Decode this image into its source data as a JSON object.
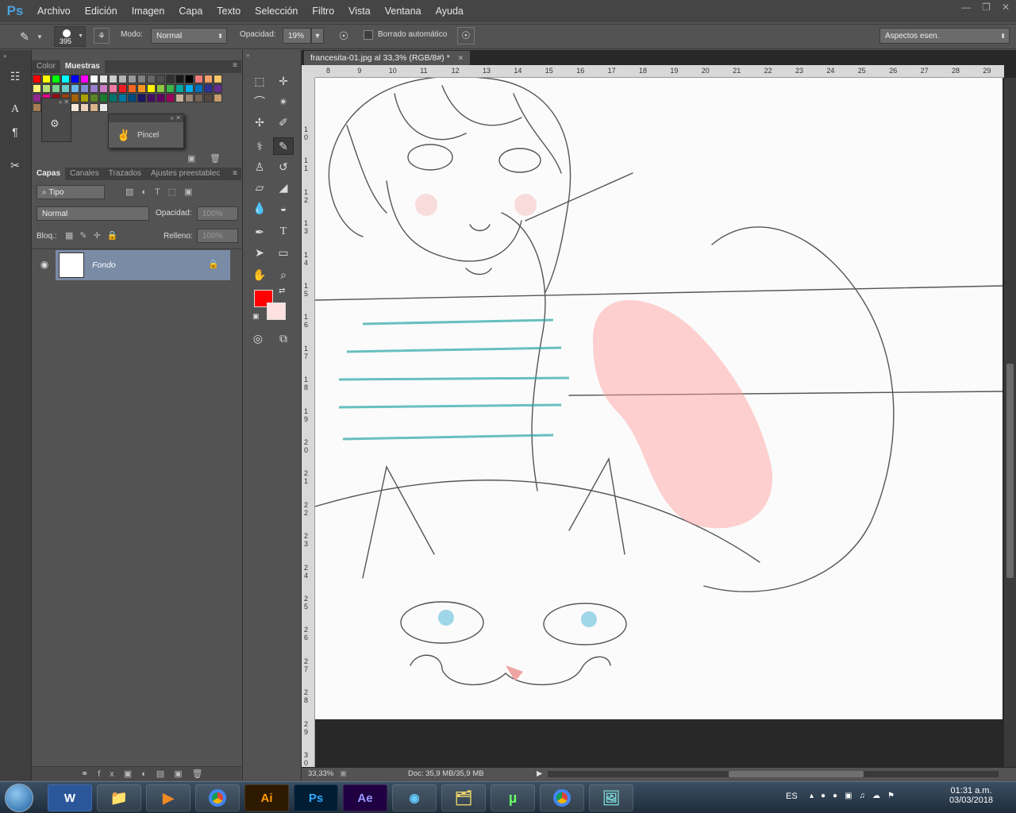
{
  "app": {
    "logo": "Ps"
  },
  "menu": [
    "Archivo",
    "Edición",
    "Imagen",
    "Capa",
    "Texto",
    "Selección",
    "Filtro",
    "Vista",
    "Ventana",
    "Ayuda"
  ],
  "options": {
    "brush_size": "395",
    "mode_label": "Modo:",
    "mode_value": "Normal",
    "opacity_label": "Opacidad:",
    "opacity_value": "19%",
    "auto_erase_label": "Borrado automático",
    "workspace": "Aspectos esen."
  },
  "swatch_panel": {
    "tabs": [
      "Color",
      "Muestras"
    ],
    "popup_label": "Pincel"
  },
  "layers_panel": {
    "tabs": [
      "Capas",
      "Canales",
      "Trazados",
      "Ajustes preestablec"
    ],
    "filter_label": "Tipo",
    "blend_mode": "Normal",
    "opacity_label": "Opacidad:",
    "opacity_value": "100%",
    "lock_label": "Bloq.:",
    "fill_label": "Relleno:",
    "fill_value": "100%",
    "layer_name": "Fondo"
  },
  "document": {
    "tab_title": "francesita-01.jpg al 33,3% (RGB/8#) *"
  },
  "ruler_top": [
    "8",
    "9",
    "10",
    "11",
    "12",
    "13",
    "14",
    "15",
    "16",
    "17",
    "18",
    "19",
    "20",
    "21",
    "22",
    "23",
    "24",
    "25",
    "26",
    "27",
    "28",
    "29"
  ],
  "ruler_left": [
    "1 0",
    "1 1",
    "1 2",
    "1 3",
    "1 4",
    "1 5",
    "1 6",
    "1 7",
    "1 8",
    "1 9",
    "2 0",
    "2 1",
    "2 2",
    "2 3",
    "2 4",
    "2 5",
    "2 6",
    "2 7",
    "2 8",
    "2 9",
    "3 0"
  ],
  "status": {
    "zoom": "33,33%",
    "doc_info": "Doc: 35,9 MB/35,9 MB"
  },
  "colors": {
    "foreground": "#ff0000",
    "background": "#fde0e0",
    "layer_selected": "#7a8ba6"
  },
  "taskbar": {
    "lang": "ES",
    "time": "01:31 a.m.",
    "date": "03/03/2018",
    "apps": [
      "word-icon",
      "folder-icon",
      "media-player-icon",
      "chrome-icon",
      "illustrator-icon",
      "photoshop-icon",
      "after-effects-icon",
      "camera-icon",
      "files-icon",
      "utorrent-icon",
      "chrome-icon",
      "photos-icon"
    ],
    "app_labels": {
      "illustrator": "Ai",
      "photoshop": "Ps",
      "after_effects": "Ae",
      "word": "W"
    }
  }
}
